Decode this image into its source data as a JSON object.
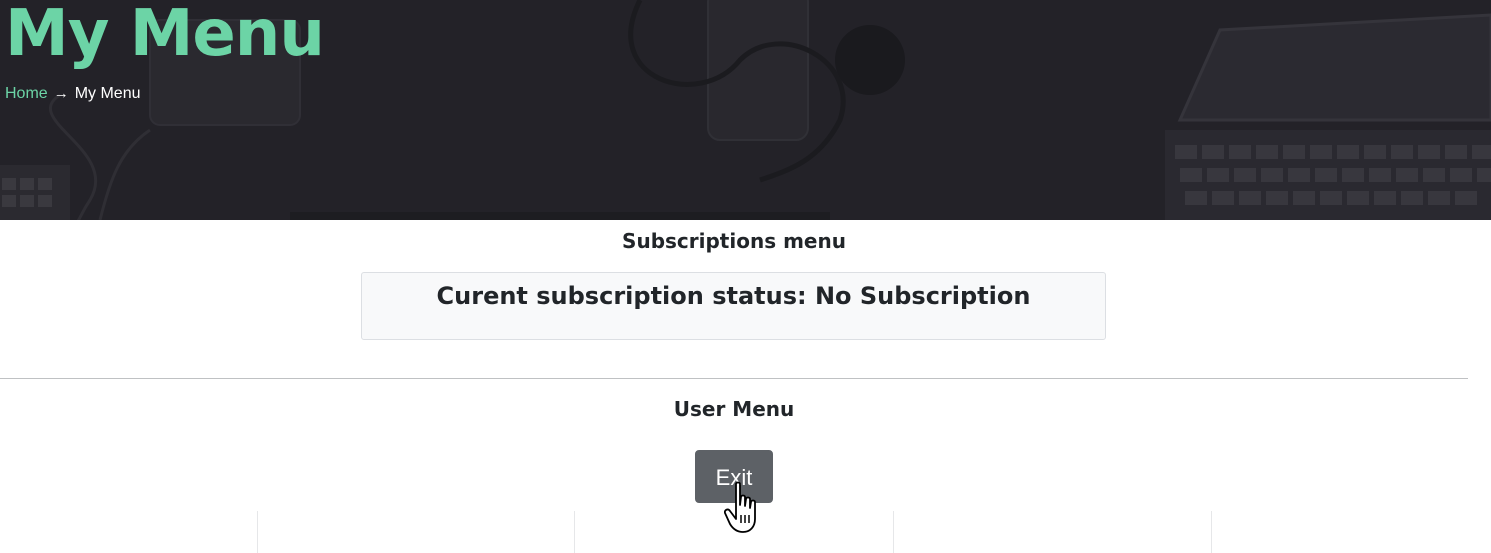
{
  "header": {
    "title": "My Menu",
    "breadcrumb": {
      "home": "Home",
      "separator": "→",
      "current": "My Menu"
    }
  },
  "subscriptions": {
    "heading": "Subscriptions menu",
    "status_text": "Curent subscription status: No Subscription"
  },
  "user_menu": {
    "heading": "User Menu",
    "exit_label": "Exit"
  },
  "colors": {
    "accent": "#6cd4a6",
    "hero_bg": "#232228",
    "button_bg": "#5d6166"
  },
  "icons": {
    "cursor": "hand-pointer-icon"
  }
}
